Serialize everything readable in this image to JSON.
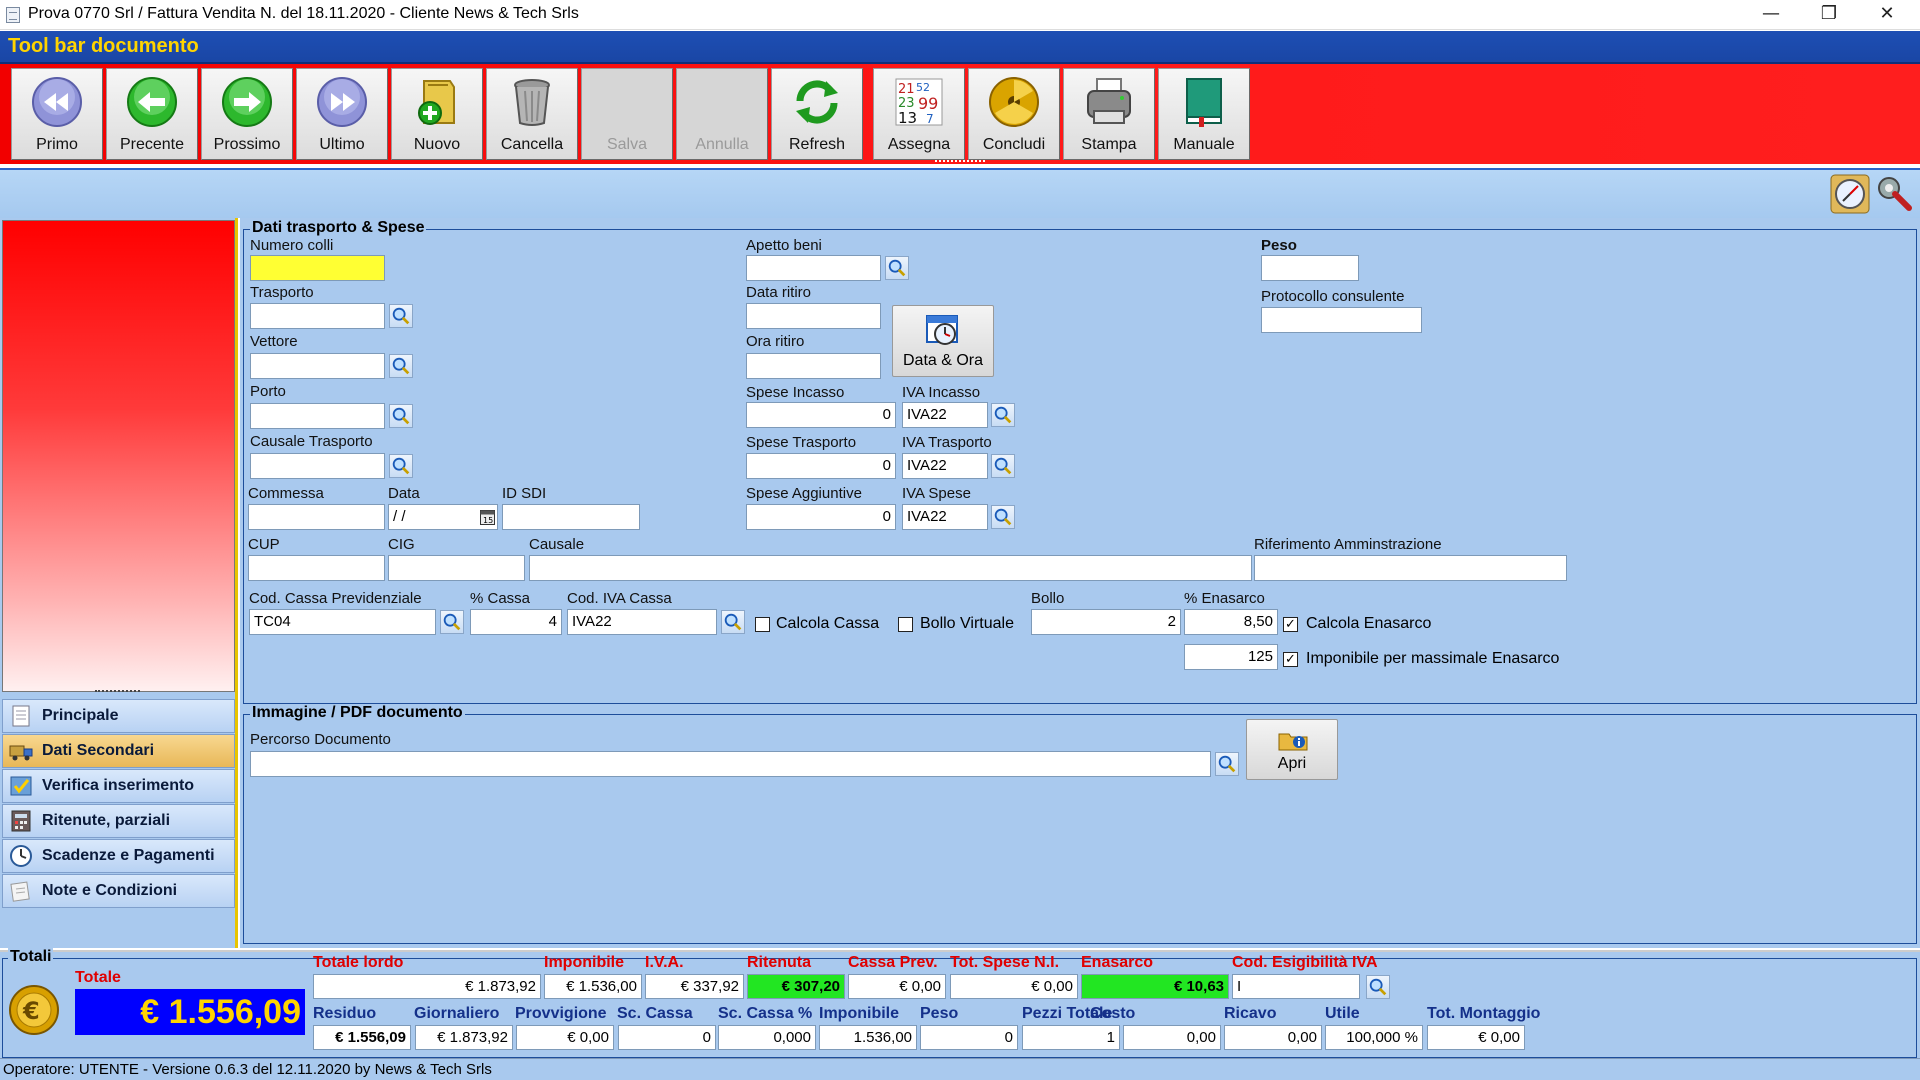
{
  "window": {
    "title": "Prova 0770 Srl / Fattura Vendita N.  del 18.11.2020 - Cliente News & Tech Srls",
    "minimize": "—",
    "maximize": "❐",
    "close": "✕"
  },
  "toolbar": {
    "header": "Tool bar documento",
    "buttons": [
      {
        "label": "Primo",
        "icon": "first-record-icon",
        "enabled": true
      },
      {
        "label": "Precente",
        "icon": "previous-record-icon",
        "enabled": true
      },
      {
        "label": "Prossimo",
        "icon": "next-record-icon",
        "enabled": true
      },
      {
        "label": "Ultimo",
        "icon": "last-record-icon",
        "enabled": true
      },
      {
        "label": "Nuovo",
        "icon": "new-document-icon",
        "enabled": true
      },
      {
        "label": "Cancella",
        "icon": "trash-icon",
        "enabled": true
      },
      {
        "label": "Salva",
        "icon": "save-icon",
        "enabled": false
      },
      {
        "label": "Annulla",
        "icon": "undo-icon",
        "enabled": false
      },
      {
        "label": "Refresh",
        "icon": "refresh-icon",
        "enabled": true
      },
      {
        "label": "Assegna",
        "icon": "numbers-icon",
        "enabled": true
      },
      {
        "label": "Concludi",
        "icon": "conclude-icon",
        "enabled": true
      },
      {
        "label": "Stampa",
        "icon": "printer-icon",
        "enabled": true
      },
      {
        "label": "Manuale",
        "icon": "book-icon",
        "enabled": true
      }
    ]
  },
  "nav": {
    "items": [
      {
        "label": "Principale",
        "icon": "document-icon",
        "active": false
      },
      {
        "label": "Dati Secondari",
        "icon": "truck-icon",
        "active": true
      },
      {
        "label": "Verifica inserimento",
        "icon": "check-icon",
        "active": false
      },
      {
        "label": "Ritenute, parziali",
        "icon": "calculator-icon",
        "active": false
      },
      {
        "label": "Scadenze e Pagamenti",
        "icon": "clock-icon",
        "active": false
      },
      {
        "label": "Note e Condizioni",
        "icon": "note-icon",
        "active": false
      }
    ]
  },
  "transport": {
    "title": "Dati trasporto & Spese",
    "numero_colli": {
      "label": "Numero colli",
      "value": ""
    },
    "trasporto": {
      "label": "Trasporto",
      "value": ""
    },
    "vettore": {
      "label": "Vettore",
      "value": ""
    },
    "porto": {
      "label": "Porto",
      "value": ""
    },
    "causale_trasporto": {
      "label": "Causale Trasporto",
      "value": ""
    },
    "commessa": {
      "label": "Commessa",
      "value": ""
    },
    "data": {
      "label": "Data",
      "value": " /  /"
    },
    "id_sdi": {
      "label": "ID SDI",
      "value": ""
    },
    "cup": {
      "label": "CUP",
      "value": ""
    },
    "cig": {
      "label": "CIG",
      "value": ""
    },
    "causale": {
      "label": "Causale",
      "value": ""
    },
    "rif_amm": {
      "label": "Riferimento Amminstrazione",
      "value": ""
    },
    "apetto_beni": {
      "label": "Apetto beni",
      "value": ""
    },
    "data_ritiro": {
      "label": "Data ritiro",
      "value": ""
    },
    "ora_ritiro": {
      "label": "Ora ritiro",
      "value": ""
    },
    "data_ora_btn": "Data & Ora",
    "spese_incasso": {
      "label": "Spese Incasso",
      "value": "0"
    },
    "iva_incasso": {
      "label": "IVA Incasso",
      "value": "IVA22"
    },
    "spese_trasporto": {
      "label": "Spese Trasporto",
      "value": "0"
    },
    "iva_trasporto": {
      "label": "IVA Trasporto",
      "value": "IVA22"
    },
    "spese_aggiuntive": {
      "label": "Spese Aggiuntive",
      "value": "0"
    },
    "iva_spese": {
      "label": "IVA Spese",
      "value": "IVA22"
    },
    "peso": {
      "label": "Peso",
      "value": ""
    },
    "protocollo": {
      "label": "Protocollo consulente",
      "value": ""
    },
    "cod_cassa": {
      "label": "Cod. Cassa Previdenziale",
      "value": "TC04"
    },
    "perc_cassa": {
      "label": "% Cassa",
      "value": "4"
    },
    "cod_iva_cassa": {
      "label": "Cod. IVA Cassa",
      "value": "IVA22"
    },
    "calcola_cassa": {
      "label": "Calcola Cassa",
      "checked": false
    },
    "bollo_virtuale": {
      "label": "Bollo Virtuale",
      "checked": false
    },
    "bollo": {
      "label": "Bollo",
      "value": "2"
    },
    "perc_enasarco": {
      "label": "% Enasarco",
      "value": "8,50"
    },
    "calcola_enasarco": {
      "label": "Calcola Enasarco",
      "checked": true
    },
    "massimale": {
      "value": "125"
    },
    "imponibile_massimale": {
      "label": "Imponibile per massimale Enasarco",
      "checked": true
    }
  },
  "image_pdf": {
    "title": "Immagine / PDF documento",
    "percorso": {
      "label": "Percorso Documento",
      "value": ""
    },
    "apri_btn": "Apri"
  },
  "totals": {
    "title": "Totali",
    "totale_label": "Totale",
    "totale_value": "€ 1.556,09",
    "row1": [
      {
        "label": "Totale lordo",
        "value": "€ 1.873,92",
        "style": ""
      },
      {
        "label": "Imponibile",
        "value": "€ 1.536,00",
        "style": ""
      },
      {
        "label": "I.V.A.",
        "value": "€ 337,92",
        "style": ""
      },
      {
        "label": "Ritenuta",
        "value": "€ 307,20",
        "style": "green"
      },
      {
        "label": "Cassa Prev.",
        "value": "€ 0,00",
        "style": ""
      },
      {
        "label": "Tot. Spese N.I.",
        "value": "€ 0,00",
        "style": ""
      },
      {
        "label": "Enasarco",
        "value": "€ 10,63",
        "style": "green"
      },
      {
        "label": "Cod. Esigibilità IVA",
        "value": "I",
        "style": "left"
      }
    ],
    "row2": [
      {
        "label": "Residuo",
        "value": "€ 1.556,09",
        "style": "bold"
      },
      {
        "label": "Giornaliero",
        "value": "€ 1.873,92",
        "style": ""
      },
      {
        "label": "Provvigione",
        "value": "€ 0,00",
        "style": ""
      },
      {
        "label": "Sc. Cassa",
        "value": "0",
        "style": ""
      },
      {
        "label": "Sc. Cassa %",
        "value": "0,000",
        "style": ""
      },
      {
        "label": "Imponibile",
        "value": "1.536,00",
        "style": ""
      },
      {
        "label": "Peso",
        "value": "0",
        "style": ""
      },
      {
        "label": "Pezzi Totale",
        "value": "1",
        "style": ""
      },
      {
        "label": "Costo",
        "value": "0,00",
        "style": ""
      },
      {
        "label": "Ricavo",
        "value": "0,00",
        "style": ""
      },
      {
        "label": "Utile",
        "value": "100,000 %",
        "style": ""
      },
      {
        "label": "Tot. Montaggio",
        "value": "€ 0,00",
        "style": ""
      }
    ]
  },
  "status": {
    "text": "Operatore: UTENTE - Versione 0.6.3 del 12.11.2020 by News & Tech Srls"
  }
}
